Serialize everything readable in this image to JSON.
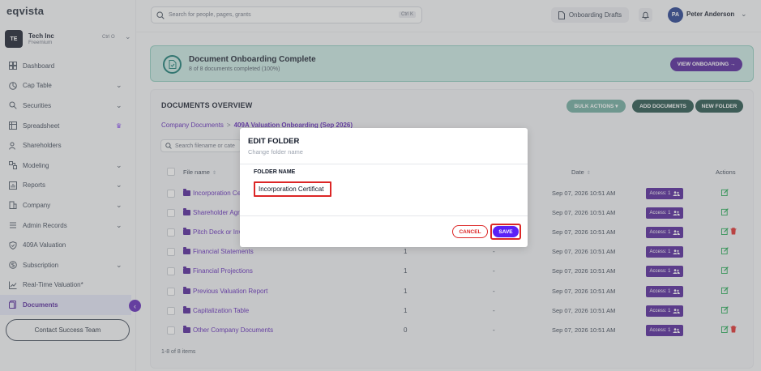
{
  "app": {
    "logo": "eqvista"
  },
  "company": {
    "initials": "TE",
    "name": "Tech Inc",
    "plan": "Freemium",
    "shortcut": "Ctrl O"
  },
  "sidebar": {
    "items": [
      {
        "label": "Dashboard",
        "icon": "dashboard-icon"
      },
      {
        "label": "Cap Table",
        "icon": "pie-chart-icon"
      },
      {
        "label": "Securities",
        "icon": "securities-icon"
      },
      {
        "label": "Spreadsheet",
        "icon": "spreadsheet-icon"
      },
      {
        "label": "Shareholders",
        "icon": "users-icon"
      },
      {
        "label": "Modeling",
        "icon": "modeling-icon"
      },
      {
        "label": "Reports",
        "icon": "reports-icon"
      },
      {
        "label": "Company",
        "icon": "company-icon"
      },
      {
        "label": "Admin Records",
        "icon": "records-icon"
      },
      {
        "label": "409A Valuation",
        "icon": "shield-icon"
      },
      {
        "label": "Subscription",
        "icon": "subscription-icon"
      },
      {
        "label": "Real-Time Valuation",
        "icon": "chart-line-icon",
        "suffix": "*"
      },
      {
        "label": "Documents",
        "icon": "documents-icon"
      }
    ],
    "contact_label": "Contact Success Team"
  },
  "topbar": {
    "search_placeholder": "Search for people, pages, grants",
    "search_shortcut": "Ctrl K",
    "drafts_label": "Onboarding Drafts",
    "user_initials": "PA",
    "user_name": "Peter Anderson"
  },
  "banner": {
    "title": "Document Onboarding Complete",
    "subtitle": "8 of 8 documents completed (100%)",
    "button": "VIEW ONBOARDING"
  },
  "documents": {
    "title": "DOCUMENTS OVERVIEW",
    "bulk_actions": "BULK ACTIONS",
    "add_documents": "ADD DOCUMENTS",
    "new_folder": "NEW FOLDER",
    "breadcrumb_root": "Company Documents",
    "breadcrumb_current": "409A Valuation Onboarding (Sep 2026)",
    "search_placeholder": "Search filename or cate",
    "columns": {
      "file_name": "File name",
      "date": "Date",
      "actions": "Actions"
    },
    "rows": [
      {
        "name": "Incorporation Ce",
        "count": "",
        "dash": "",
        "date": "Sep 07, 2026 10:51 AM",
        "access": "Access: 1",
        "delete": false
      },
      {
        "name": "Shareholder Agre",
        "count": "",
        "dash": "",
        "date": "Sep 07, 2026 10:51 AM",
        "access": "Access: 1",
        "delete": false
      },
      {
        "name": "Pitch Deck or Inv",
        "count": "",
        "dash": "",
        "date": "Sep 07, 2026 10:51 AM",
        "access": "Access: 1",
        "delete": true
      },
      {
        "name": "Financial Statements",
        "count": "1",
        "dash": "-",
        "date": "Sep 07, 2026 10:51 AM",
        "access": "Access: 1",
        "delete": false
      },
      {
        "name": "Financial Projections",
        "count": "1",
        "dash": "-",
        "date": "Sep 07, 2026 10:51 AM",
        "access": "Access: 1",
        "delete": false
      },
      {
        "name": "Previous Valuation Report",
        "count": "1",
        "dash": "-",
        "date": "Sep 07, 2026 10:51 AM",
        "access": "Access: 1",
        "delete": false
      },
      {
        "name": "Capitalization Table",
        "count": "1",
        "dash": "-",
        "date": "Sep 07, 2026 10:51 AM",
        "access": "Access: 1",
        "delete": false
      },
      {
        "name": "Other Company Documents",
        "count": "0",
        "dash": "-",
        "date": "Sep 07, 2026 10:51 AM",
        "access": "Access: 1",
        "delete": true
      }
    ],
    "items_count": "1-8 of 8 items"
  },
  "modal": {
    "title": "EDIT FOLDER",
    "subtitle": "Change folder name",
    "field_label": "FOLDER NAME",
    "field_value": "Incorporation Certificat",
    "cancel": "CANCEL",
    "save": "SAVE"
  },
  "colors": {
    "brand": "#4c1d95",
    "accent": "#5b21f6",
    "teal": "#1f4e46",
    "highlight": "#dc2626"
  }
}
